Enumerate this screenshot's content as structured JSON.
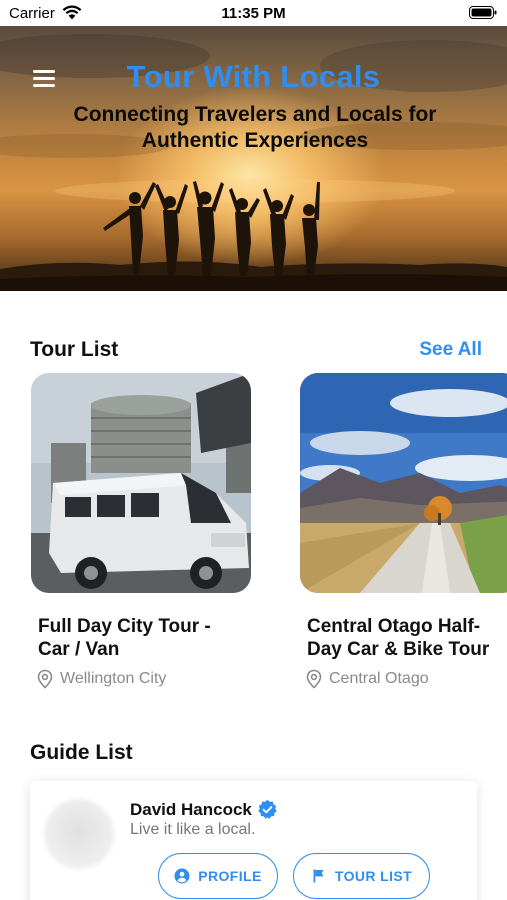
{
  "status_bar": {
    "carrier": "Carrier",
    "time": "11:35 PM"
  },
  "hero": {
    "title": "Tour With Locals",
    "subtitle": "Connecting Travelers and Locals for Authentic Experiences"
  },
  "tour_section": {
    "title": "Tour List",
    "see_all": "See All",
    "tours": [
      {
        "name": "Full Day City Tour - Car / Van",
        "location": "Wellington City"
      },
      {
        "name": "Central Otago Half-Day Car & Bike Tour",
        "location": "Central Otago"
      }
    ]
  },
  "guide_section": {
    "title": "Guide List",
    "guides": [
      {
        "name": "David Hancock",
        "tagline": "Live it like a local.",
        "profile_label": "PROFILE",
        "tour_list_label": "TOUR LIST"
      }
    ]
  },
  "colors": {
    "accent": "#2f8ef0",
    "text": "#111111",
    "muted": "#8a8a8a"
  },
  "icons": [
    "wifi-icon",
    "battery-icon",
    "menu-icon",
    "pin-icon",
    "verified-icon",
    "profile-icon",
    "flag-icon"
  ]
}
